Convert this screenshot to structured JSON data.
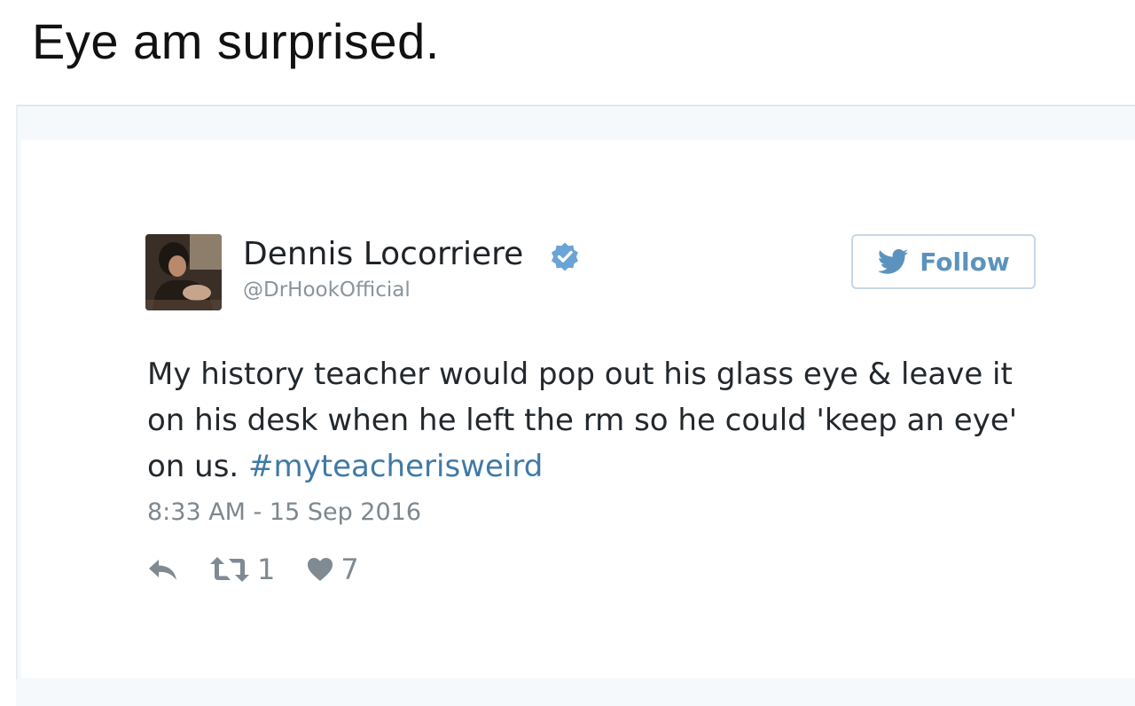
{
  "caption": "Eye am surprised.",
  "tweet": {
    "display_name": "Dennis Locorriere",
    "handle": "@DrHookOfficial",
    "follow_label": "Follow",
    "text_main": "My history teacher would pop out his glass eye & leave it on his desk when he left the rm so he could 'keep an eye' on us.",
    "hashtag": "#myteacherisweird",
    "timestamp": "8:33 AM - 15 Sep 2016",
    "retweet_count": "1",
    "like_count": "7"
  },
  "colors": {
    "accent": "#3f7aa6",
    "follow_text": "#5c93be",
    "verified": "#6aa3d6"
  },
  "icons": {
    "verified": "verified-badge-icon",
    "follow": "twitter-bird-icon",
    "reply": "reply-icon",
    "retweet": "retweet-icon",
    "like": "heart-icon"
  }
}
